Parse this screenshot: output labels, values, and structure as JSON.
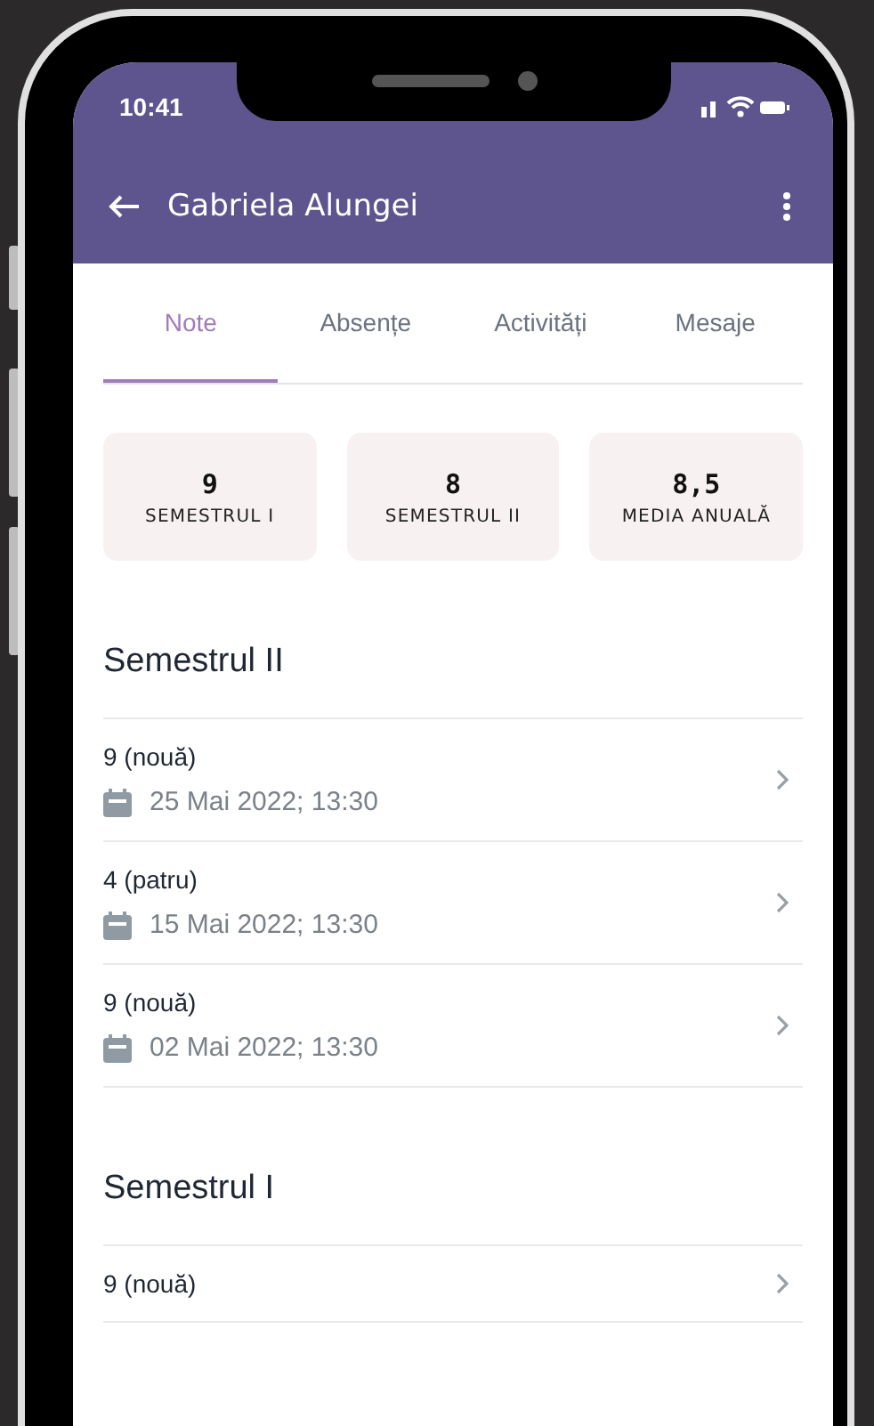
{
  "status_bar": {
    "time": "10:41"
  },
  "app_bar": {
    "title": "Gabriela Alungei"
  },
  "tabs": [
    {
      "label": "Note",
      "selected": true
    },
    {
      "label": "Absențe",
      "selected": false
    },
    {
      "label": "Activități",
      "selected": false
    },
    {
      "label": "Mesaje",
      "selected": false
    }
  ],
  "summary": [
    {
      "value": "9",
      "label": "SEMESTRUL I"
    },
    {
      "value": "8",
      "label": "SEMESTRUL II"
    },
    {
      "value": "8,5",
      "label": "MEDIA ANUALĂ"
    }
  ],
  "sections": [
    {
      "title": "Semestrul II",
      "grades": [
        {
          "grade": "9 (nouă)",
          "date": "25 Mai 2022; 13:30"
        },
        {
          "grade": "4 (patru)",
          "date": "15 Mai 2022; 13:30"
        },
        {
          "grade": "9 (nouă)",
          "date": "02 Mai 2022; 13:30"
        }
      ]
    },
    {
      "title": "Semestrul I",
      "grades": [
        {
          "grade": "9 (nouă)"
        }
      ]
    }
  ]
}
